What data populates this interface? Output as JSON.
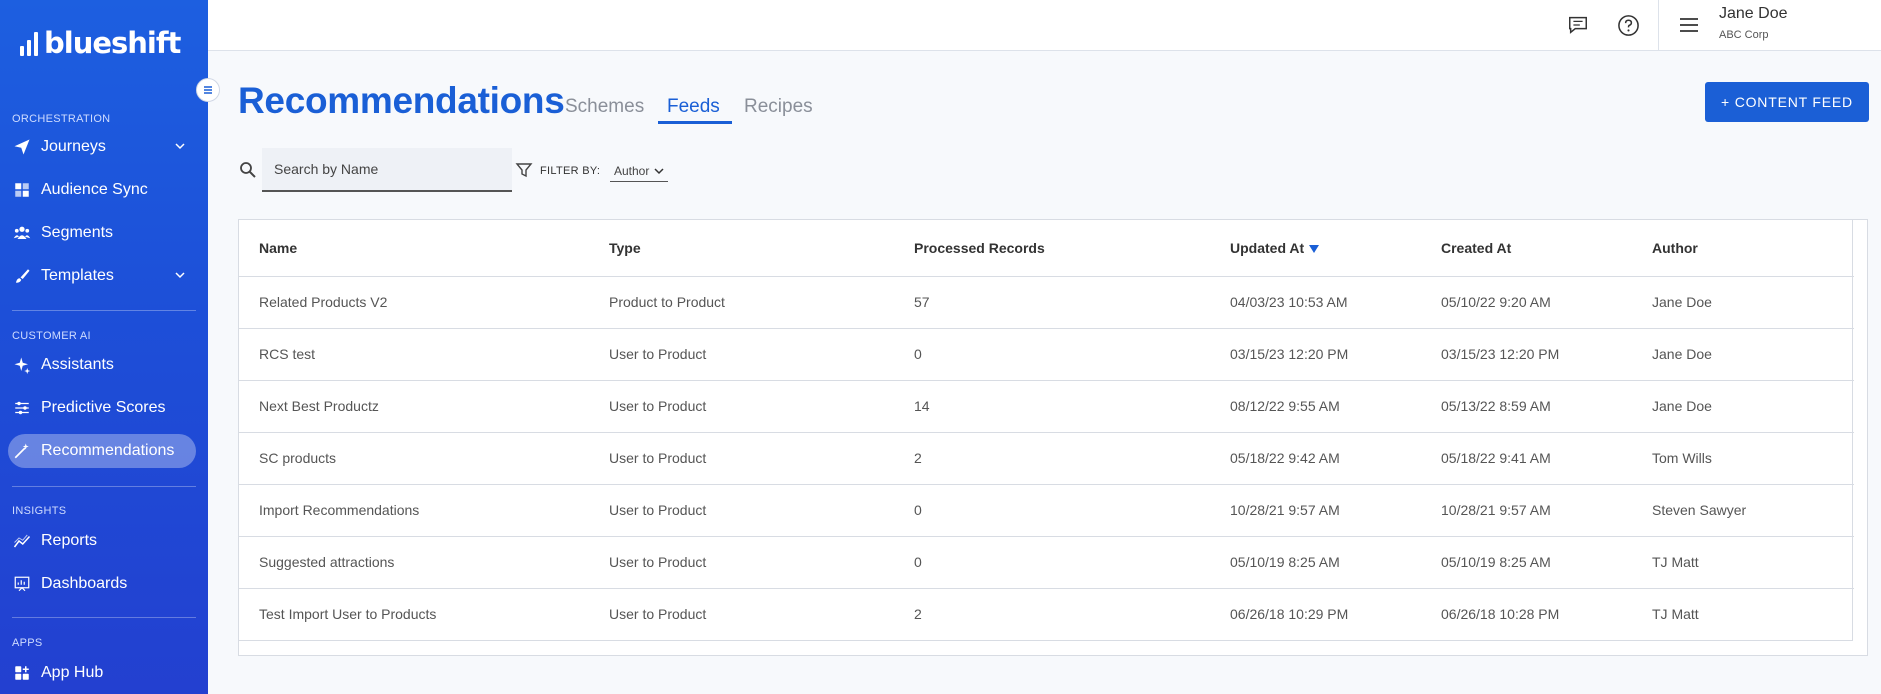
{
  "brand": {
    "name": "blueshift"
  },
  "sidebar": {
    "sections": [
      {
        "label": "ORCHESTRATION",
        "items": [
          {
            "label": "Journeys",
            "icon": "paper-plane-icon",
            "expandable": true
          },
          {
            "label": "Audience Sync",
            "icon": "puzzle-icon"
          },
          {
            "label": "Segments",
            "icon": "people-icon"
          },
          {
            "label": "Templates",
            "icon": "brush-icon",
            "expandable": true
          }
        ]
      },
      {
        "label": "CUSTOMER AI",
        "items": [
          {
            "label": "Assistants",
            "icon": "sparkle-icon"
          },
          {
            "label": "Predictive Scores",
            "icon": "sliders-icon"
          },
          {
            "label": "Recommendations",
            "icon": "magic-wand-icon",
            "active": true
          }
        ]
      },
      {
        "label": "INSIGHTS",
        "items": [
          {
            "label": "Reports",
            "icon": "line-chart-icon"
          },
          {
            "label": "Dashboards",
            "icon": "dashboard-icon"
          }
        ]
      },
      {
        "label": "APPS",
        "items": [
          {
            "label": "App Hub",
            "icon": "grid-plus-icon"
          }
        ]
      }
    ]
  },
  "user": {
    "name": "Jane Doe",
    "org": "ABC Corp"
  },
  "page": {
    "title": "Recommendations",
    "tabs": [
      {
        "label": "Schemes",
        "active": false
      },
      {
        "label": "Feeds",
        "active": true
      },
      {
        "label": "Recipes",
        "active": false
      }
    ],
    "add_button": "+ CONTENT FEED"
  },
  "filters": {
    "search_placeholder": "Search by Name",
    "filter_by_label": "FILTER BY:",
    "filter_value": "Author"
  },
  "table": {
    "columns": [
      "Name",
      "Type",
      "Processed Records",
      "Updated At",
      "Created At",
      "Author"
    ],
    "sorted_column": "Updated At",
    "rows": [
      [
        "Related Products V2",
        "Product to Product",
        "57",
        "04/03/23 10:53 AM",
        "05/10/22 9:20 AM",
        "Jane Doe"
      ],
      [
        "RCS test",
        "User to Product",
        "0",
        "03/15/23 12:20 PM",
        "03/15/23 12:20 PM",
        "Jane Doe"
      ],
      [
        "Next Best Productz",
        "User to Product",
        "14",
        "08/12/22 9:55 AM",
        "05/13/22 8:59 AM",
        "Jane Doe"
      ],
      [
        "SC products",
        "User to Product",
        "2",
        "05/18/22 9:42 AM",
        "05/18/22 9:41 AM",
        "Tom Wills"
      ],
      [
        "Import Recommendations",
        "User to Product",
        "0",
        "10/28/21 9:57 AM",
        "10/28/21 9:57 AM",
        "Steven Sawyer"
      ],
      [
        "Suggested attractions",
        "User to Product",
        "0",
        "05/10/19 8:25 AM",
        "05/10/19 8:25 AM",
        "TJ Matt"
      ],
      [
        "Test Import User to Products",
        "User to Product",
        "2",
        "06/26/18 10:29 PM",
        "06/26/18 10:28 PM",
        "TJ Matt"
      ]
    ]
  }
}
